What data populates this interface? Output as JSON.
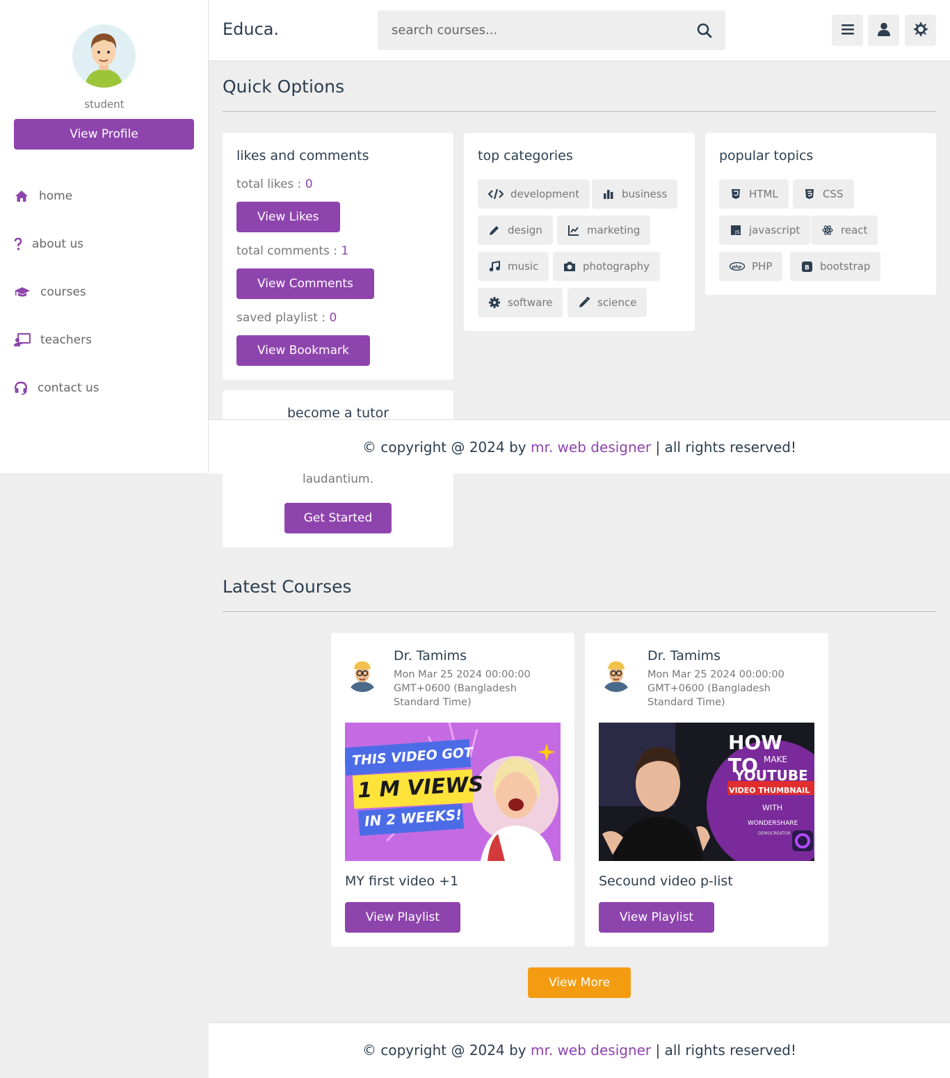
{
  "sidebar": {
    "role": "student",
    "view_profile": "View Profile",
    "items": [
      {
        "label": "home",
        "icon": "home-icon"
      },
      {
        "label": "about us",
        "icon": "question-icon"
      },
      {
        "label": "courses",
        "icon": "graduation-cap-icon"
      },
      {
        "label": "teachers",
        "icon": "chalkboard-teacher-icon"
      },
      {
        "label": "contact us",
        "icon": "headset-icon"
      }
    ]
  },
  "header": {
    "logo": "Educa.",
    "search_placeholder": "search courses..."
  },
  "quick_options": {
    "title": "Quick Options",
    "likes": {
      "title": "likes and comments",
      "total_likes_label": "total likes : ",
      "total_likes": "0",
      "view_likes": "View Likes",
      "total_comments_label": "total comments : ",
      "total_comments": "1",
      "view_comments": "View Comments",
      "saved_label": "saved playlist : ",
      "saved": "0",
      "view_bookmark": "View Bookmark"
    },
    "categories": {
      "title": "top categories",
      "items": [
        "development",
        "business",
        "design",
        "marketing",
        "music",
        "photography",
        "software",
        "science"
      ]
    },
    "topics": {
      "title": "popular topics",
      "items": [
        "HTML",
        "CSS",
        "javascript",
        "react",
        "PHP",
        "bootstrap"
      ]
    },
    "tutor": {
      "title": "become a tutor",
      "text_tail": "laudantium.",
      "button": "Get Started"
    }
  },
  "latest": {
    "title": "Latest Courses",
    "courses": [
      {
        "tutor": "Dr. Tamims",
        "date": "Mon Mar 25 2024 00:00:00 GMT+0600 (Bangladesh Standard Time)",
        "title": "MY first video +1",
        "button": "View Playlist",
        "thumb_lines": [
          "THIS VIDEO GOT",
          "1 M VIEWS",
          "IN 2 WEEKS!"
        ]
      },
      {
        "tutor": "Dr. Tamims",
        "date": "Mon Mar 25 2024 00:00:00 GMT+0600 (Bangladesh Standard Time)",
        "title": "Secound video p-list",
        "button": "View Playlist",
        "thumb_lines": [
          "HOW TO",
          "MAKE",
          "YOUTUBE",
          "VIDEO THUMBNAIL",
          "WITH",
          "WONDERSHARE",
          "DEMOCREATOR"
        ]
      }
    ],
    "view_more": "View More"
  },
  "footer": {
    "prefix": "© copyright @ 2024 by ",
    "link": "mr. web designer",
    "suffix": " | all rights reserved!"
  }
}
